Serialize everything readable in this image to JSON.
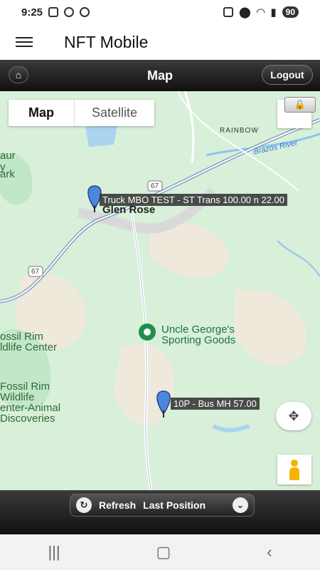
{
  "status": {
    "time": "9:25",
    "battery": "90"
  },
  "app": {
    "title": "NFT Mobile"
  },
  "nav": {
    "title": "Map",
    "logout": "Logout"
  },
  "map": {
    "type_tabs": [
      "Map",
      "Satellite"
    ],
    "labels": {
      "rainbow": "RAINBOW",
      "brazos": "Brazos River",
      "glen_rose": "Glen Rose",
      "hwy67_top": "67",
      "hwy67_left": "67",
      "park_partial_1": "aur",
      "park_partial_2": "y",
      "park_partial_3": "ark",
      "fossil_rim_1": "ossil Rim",
      "fossil_rim_2": "ldlife Center",
      "fossil_rim_3": "Fossil Rim",
      "fossil_rim_4": "Wildlife",
      "fossil_rim_5": "enter-Animal",
      "fossil_rim_6": "Discoveries",
      "poi_1": "Uncle George's",
      "poi_2": "Sporting Goods"
    },
    "markers": [
      {
        "label": "Truck MBO TEST - ST Trans 100.00 n 22.00"
      },
      {
        "label": "10P - Bus MH 57.00"
      }
    ]
  },
  "bottom": {
    "refresh": "Refresh",
    "last_position": "Last Position"
  },
  "icons": {
    "home": "home-icon",
    "menu": "menu-icon",
    "lock": "lock-icon",
    "refresh": "refresh-icon",
    "chevron": "chevron-down-icon"
  }
}
